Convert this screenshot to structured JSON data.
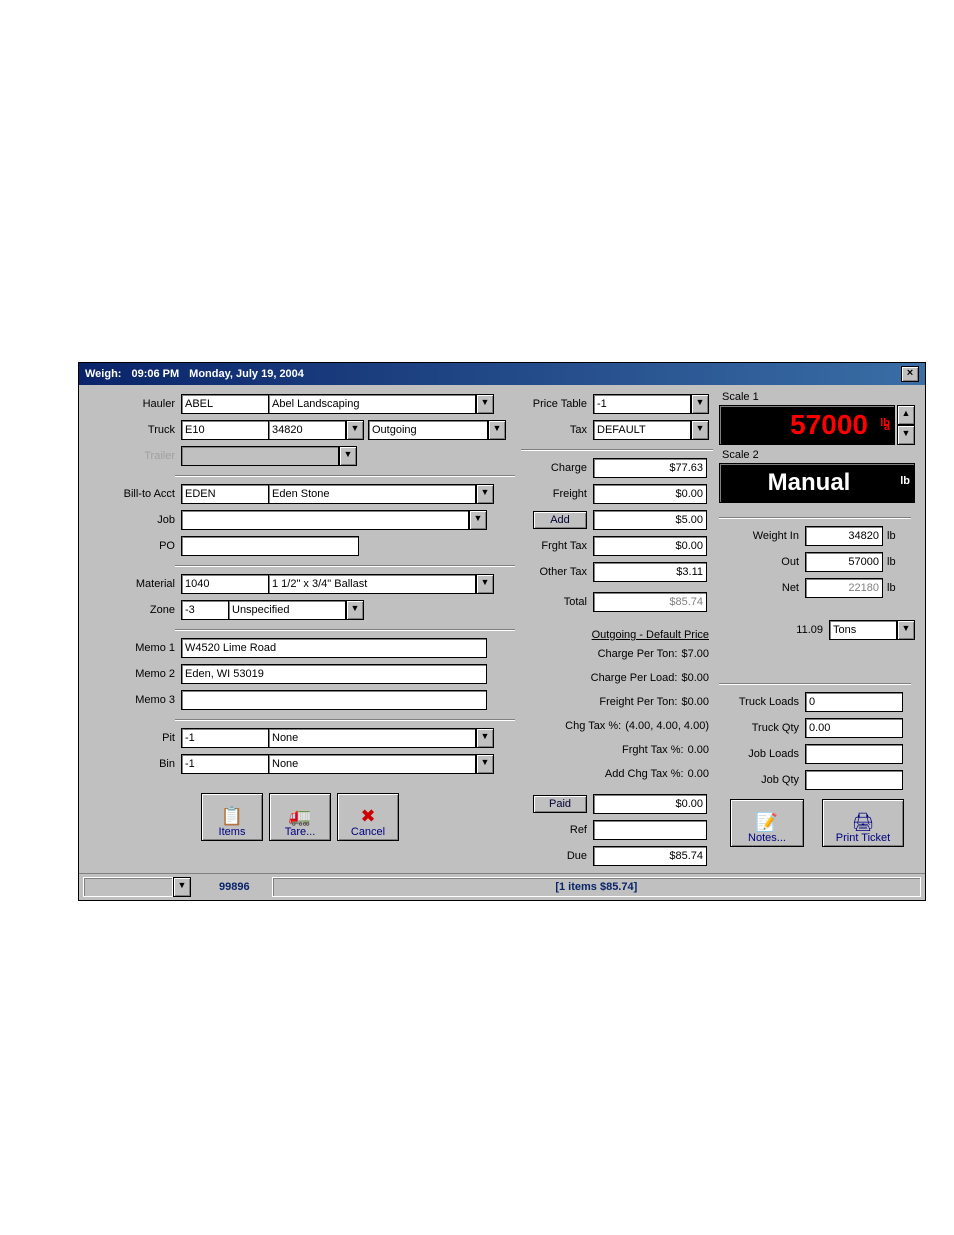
{
  "title": {
    "prefix": "Weigh:",
    "time": "09:06 PM",
    "date": "Monday, July 19, 2004"
  },
  "left": {
    "labels": {
      "hauler": "Hauler",
      "truck": "Truck",
      "trailer": "Trailer",
      "billto": "Bill-to Acct",
      "job": "Job",
      "po": "PO",
      "material": "Material",
      "zone": "Zone",
      "memo1": "Memo 1",
      "memo2": "Memo 2",
      "memo3": "Memo 3",
      "pit": "Pit",
      "bin": "Bin"
    },
    "hauler": {
      "code": "ABEL",
      "name": "Abel Landscaping"
    },
    "truck": {
      "code": "E10",
      "tare": "34820",
      "direction": "Outgoing"
    },
    "trailer": {
      "value": ""
    },
    "billto": {
      "code": "EDEN",
      "name": "Eden Stone"
    },
    "job": "",
    "po": "",
    "material": {
      "code": "1040",
      "desc": "1 1/2\" x 3/4\" Ballast"
    },
    "zone": {
      "code": "-3",
      "desc": "Unspecified"
    },
    "memo1": "W4520 Lime Road",
    "memo2": "Eden, WI 53019",
    "memo3": "",
    "pit": {
      "code": "-1",
      "desc": "None"
    },
    "bin": {
      "code": "-1",
      "desc": "None"
    },
    "buttons": {
      "items": "Items",
      "tare": "Tare...",
      "cancel": "Cancel"
    }
  },
  "mid": {
    "labels": {
      "price_table": "Price Table",
      "tax": "Tax",
      "charge": "Charge",
      "freight": "Freight",
      "add": "Add",
      "frght_tax": "Frght Tax",
      "other_tax": "Other Tax",
      "total": "Total",
      "paid": "Paid",
      "ref": "Ref",
      "due": "Due"
    },
    "price_table": "-1",
    "tax": "DEFAULT",
    "charge": "$77.63",
    "freight": "$0.00",
    "add": "$5.00",
    "frght_tax": "$0.00",
    "other_tax": "$3.11",
    "total": "$85.74",
    "paid": "$0.00",
    "ref": "",
    "due": "$85.74",
    "info": {
      "header": "Outgoing - Default Price",
      "lines": {
        "cpt_l": "Charge Per Ton:",
        "cpt_v": "$7.00",
        "cpl_l": "Charge Per Load:",
        "cpl_v": "$0.00",
        "fpt_l": "Freight Per Ton:",
        "fpt_v": "$0.00",
        "cht_l": "Chg Tax %:",
        "cht_v": "(4.00, 4.00, 4.00)",
        "ft_l": "Frght Tax %:",
        "ft_v": "0.00",
        "act_l": "Add Chg Tax %:",
        "act_v": "0.00"
      }
    }
  },
  "right": {
    "scale1": {
      "name": "Scale 1",
      "value": "57000",
      "unit": "lb",
      "sub": "a"
    },
    "scale2": {
      "name": "Scale 2",
      "value": "Manual",
      "unit": "lb"
    },
    "labels": {
      "weight_in": "Weight In",
      "out": "Out",
      "net": "Net",
      "truck_loads": "Truck Loads",
      "truck_qty": "Truck Qty",
      "job_loads": "Job Loads",
      "job_qty": "Job Qty"
    },
    "weight_in": "34820",
    "out": "57000",
    "net": "22180",
    "unit": "lb",
    "converted": "11.09",
    "conv_unit": "Tons",
    "truck_loads": "0",
    "truck_qty": "0.00",
    "job_loads": "",
    "job_qty": "",
    "buttons": {
      "notes": "Notes...",
      "print": "Print Ticket"
    }
  },
  "status": {
    "ticket": "99896",
    "summary": "[1 items  $85.74]"
  }
}
